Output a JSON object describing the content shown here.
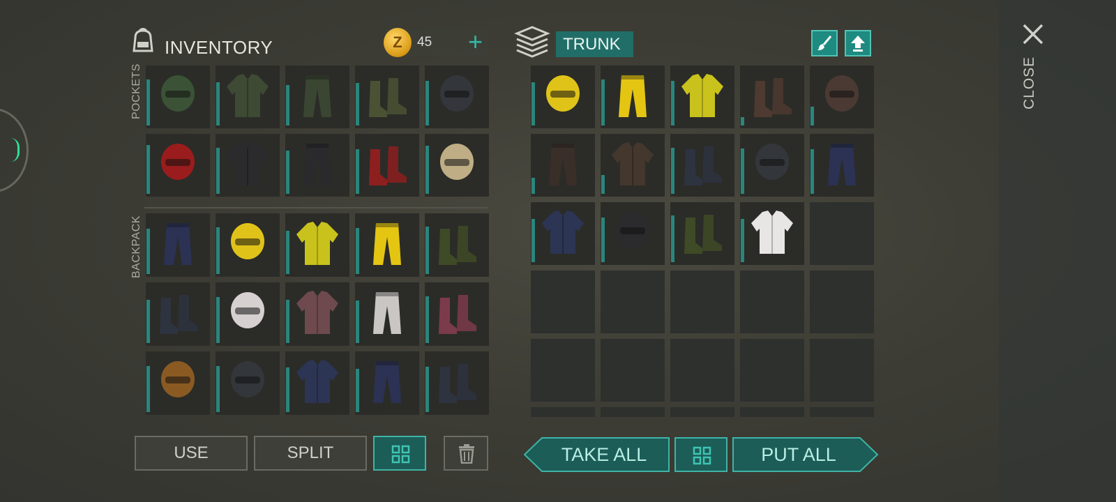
{
  "inventory": {
    "title": "INVENTORY",
    "coins": "45",
    "coin_symbol": "Z",
    "pockets_label": "POCKETS",
    "backpack_label": "BACKPACK",
    "pockets": [
      {
        "icon": "balaclava-icon",
        "color": "#3b5236",
        "dur": 0.85
      },
      {
        "icon": "camo-jacket-icon",
        "color": "#3e4a34",
        "dur": 0.8
      },
      {
        "icon": "camo-pants-icon",
        "color": "#3a4632",
        "dur": 0.75
      },
      {
        "icon": "military-boots-icon",
        "color": "#4a5233",
        "dur": 0.78
      },
      {
        "icon": "tactical-helmet-icon",
        "color": "#33363a",
        "dur": 0.82
      },
      {
        "icon": "racing-helmet-icon",
        "color": "#9a1c1c",
        "dur": 0.9
      },
      {
        "icon": "racing-jacket-icon",
        "color": "#2b2b2e",
        "dur": 0.85
      },
      {
        "icon": "racing-pants-icon",
        "color": "#2a2a2d",
        "dur": 0.8
      },
      {
        "icon": "racing-boots-icon",
        "color": "#8e1f1f",
        "dur": 0.82
      },
      {
        "icon": "goggles-helmet-icon",
        "color": "#bfae85",
        "dur": 0.88
      }
    ],
    "backpack": [
      {
        "icon": "cargo-pants-icon",
        "color": "#2b3253",
        "dur": 0.83
      },
      {
        "icon": "hazmat-hood-icon",
        "color": "#e0c319",
        "dur": 0.86
      },
      {
        "icon": "hazmat-jacket-icon",
        "color": "#c9c21c",
        "dur": 0.8
      },
      {
        "icon": "hazmat-pants-icon",
        "color": "#e4c512",
        "dur": 0.84
      },
      {
        "icon": "rubber-boots-icon",
        "color": "#3f4a26",
        "dur": 0.87
      },
      {
        "icon": "leather-boots-icon",
        "color": "#2e3340",
        "dur": 0.8
      },
      {
        "icon": "scarf-hood-icon",
        "color": "#d6d0d0",
        "dur": 0.85
      },
      {
        "icon": "bone-armor-icon",
        "color": "#6e4a4e",
        "dur": 0.8
      },
      {
        "icon": "padded-pants-icon",
        "color": "#c9c6c4",
        "dur": 0.78
      },
      {
        "icon": "spiked-boots-icon",
        "color": "#7c3b4a",
        "dur": 0.86
      },
      {
        "icon": "visor-helmet-icon",
        "color": "#8a5a22",
        "dur": 0.84
      },
      {
        "icon": "tactical-helmet-icon",
        "color": "#33363a",
        "dur": 0.85
      },
      {
        "icon": "police-vest-icon",
        "color": "#2d3554",
        "dur": 0.82
      },
      {
        "icon": "cargo-pants-icon",
        "color": "#2b3253",
        "dur": 0.8
      },
      {
        "icon": "leather-boots-icon",
        "color": "#2e3340",
        "dur": 0.83
      }
    ],
    "buttons": {
      "use": "USE",
      "split": "SPLIT"
    }
  },
  "trunk": {
    "title": "TRUNK",
    "items": [
      {
        "icon": "hazmat-hood-icon",
        "color": "#e0c319",
        "dur": 0.8
      },
      {
        "icon": "hazmat-pants-icon",
        "color": "#e4c512",
        "dur": 0.85
      },
      {
        "icon": "hazmat-jacket-icon",
        "color": "#c9c21c",
        "dur": 0.82
      },
      {
        "icon": "heavy-boots-icon",
        "color": "#4e3a30",
        "dur": 0.15
      },
      {
        "icon": "gas-mask-icon",
        "color": "#4b3a33",
        "dur": 0.35
      },
      {
        "icon": "armored-pants-icon",
        "color": "#3a2e28",
        "dur": 0.3
      },
      {
        "icon": "spiked-armor-icon",
        "color": "#44372d",
        "dur": 0.35
      },
      {
        "icon": "leather-boots-icon",
        "color": "#2e3340",
        "dur": 0.85
      },
      {
        "icon": "tactical-helmet-icon",
        "color": "#33363a",
        "dur": 0.83
      },
      {
        "icon": "cargo-pants-icon",
        "color": "#2b3253",
        "dur": 0.82
      },
      {
        "icon": "police-vest-icon",
        "color": "#2d3554",
        "dur": 0.8
      },
      {
        "icon": "bandana-helmet-icon",
        "color": "#2b2b2d",
        "dur": 0.82
      },
      {
        "icon": "rubber-boots-icon",
        "color": "#3f4a26",
        "dur": 0.86
      },
      {
        "icon": "tank-top-icon",
        "color": "#e8e6e4",
        "dur": 0.8
      }
    ],
    "total_slots": 30,
    "buttons": {
      "take_all": "TAKE ALL",
      "put_all": "PUT ALL"
    }
  },
  "close_label": "CLOSE",
  "colors": {
    "accent": "#1e8a80",
    "accent_border": "#51c5b6",
    "durability": "#2b857c"
  }
}
